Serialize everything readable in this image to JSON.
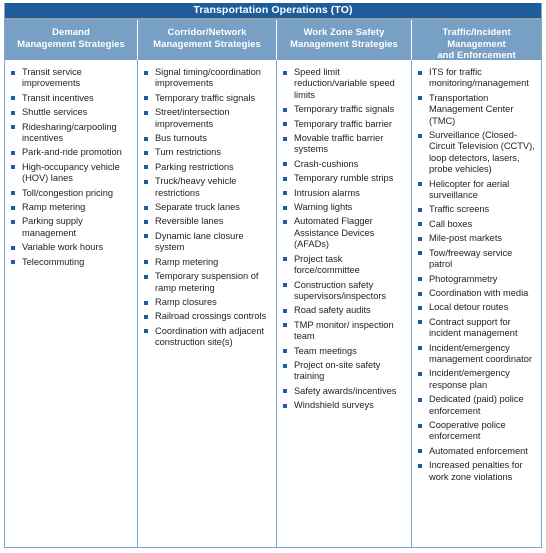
{
  "title": "Transportation Operations (TO)",
  "colors": {
    "title_bar": "#1d5d9b",
    "header_band": "#789fc4",
    "bullet": "#1f5c9e",
    "border": "#7da7cd",
    "text": "#231f20"
  },
  "columns": [
    {
      "header_line1": "Demand",
      "header_line2": "Management Strategies",
      "items": [
        "Transit service improvements",
        "Transit incentives",
        "Shuttle services",
        "Ridesharing/carpooling incentives",
        "Park-and-ride promotion",
        "High-occupancy vehicle (HOV) lanes",
        "Toll/congestion pricing",
        "Ramp metering",
        "Parking supply management",
        "Variable work hours",
        "Telecommuting"
      ]
    },
    {
      "header_line1": "Corridor/Network",
      "header_line2": "Management Strategies",
      "items": [
        "Signal timing/coordination improvements",
        "Temporary traffic signals",
        "Street/intersection improvements",
        "Bus turnouts",
        "Turn restrictions",
        "Parking restrictions",
        "Truck/heavy vehicle restrictions",
        "Separate truck lanes",
        "Reversible lanes",
        "Dynamic lane closure system",
        "Ramp metering",
        "Temporary suspension of ramp metering",
        "Ramp closures",
        "Railroad crossings controls",
        "Coordination with adjacent construction site(s)"
      ]
    },
    {
      "header_line1": "Work Zone Safety",
      "header_line2": "Management Strategies",
      "items": [
        "Speed limit reduction/variable speed limits",
        "Temporary traffic signals",
        "Temporary traffic barrier",
        "Movable traffic barrier systems",
        "Crash-cushions",
        "Temporary rumble strips",
        "Intrusion alarms",
        "Warning lights",
        "Automated Flagger Assistance Devices (AFADs)",
        "Project task force/committee",
        "Construction safety supervisors/inspectors",
        "Road safety audits",
        "TMP monitor/ inspection team",
        "Team meetings",
        "Project on-site safety training",
        "Safety awards/incentives",
        "Windshield surveys"
      ]
    },
    {
      "header_line1": "Traffic/Incident Management",
      "header_line2": "and Enforcement Strategies",
      "items": [
        "ITS for traffic monitoring/management",
        "Transportation Management Center (TMC)",
        "Surveillance (Closed-Circuit Television (CCTV), loop detectors, lasers, probe vehicles)",
        "Helicopter for aerial surveillance",
        "Traffic screens",
        "Call boxes",
        "Mile-post markets",
        "Tow/freeway service patrol",
        "Photogrammetry",
        "Coordination with media",
        "Local detour routes",
        "Contract support for incident management",
        "Incident/emergency management coordinator",
        "Incident/emergency response plan",
        "Dedicated (paid) police enforcement",
        "Cooperative police enforcement",
        "Automated enforcement",
        "Increased penalties for work zone violations"
      ]
    }
  ]
}
